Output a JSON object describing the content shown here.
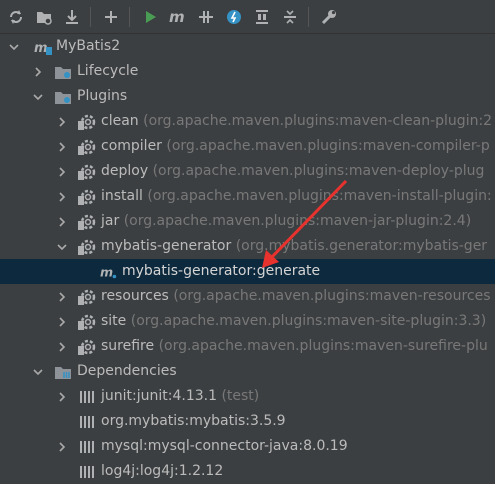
{
  "toolbar": {
    "buttons": [
      "reload-icon",
      "add-folder-icon",
      "download-icon",
      "add-icon",
      "run-icon",
      "maven-icon",
      "toggle-offline-icon",
      "thread-icon",
      "show-dependencies-icon",
      "collapse-all-icon",
      "settings-icon"
    ]
  },
  "tree": {
    "project": "MyBatis2",
    "lifecycle": "Lifecycle",
    "plugins": "Plugins",
    "plugin_items": [
      {
        "name": "clean",
        "detail": "(org.apache.maven.plugins:maven-clean-plugin:2"
      },
      {
        "name": "compiler",
        "detail": "(org.apache.maven.plugins:maven-compiler-p"
      },
      {
        "name": "deploy",
        "detail": "(org.apache.maven.plugins:maven-deploy-plug"
      },
      {
        "name": "install",
        "detail": "(org.apache.maven.plugins:maven-install-plugin:"
      },
      {
        "name": "jar",
        "detail": "(org.apache.maven.plugins:maven-jar-plugin:2.4)"
      },
      {
        "name": "mybatis-generator",
        "detail": "(org.mybatis.generator:mybatis-ger"
      },
      {
        "name": "resources",
        "detail": "(org.apache.maven.plugins:maven-resources"
      },
      {
        "name": "site",
        "detail": "(org.apache.maven.plugins:maven-site-plugin:3.3)"
      },
      {
        "name": "surefire",
        "detail": "(org.apache.maven.plugins:maven-surefire-plu"
      }
    ],
    "goal": "mybatis-generator:generate",
    "dependencies": "Dependencies",
    "dependency_items": [
      {
        "name": "junit:junit:4.13.1",
        "detail": "(test)"
      },
      {
        "name": "org.mybatis:mybatis:3.5.9",
        "detail": ""
      },
      {
        "name": "mysql:mysql-connector-java:8.0.19",
        "detail": ""
      },
      {
        "name": "log4j:log4j:1.2.12",
        "detail": ""
      }
    ]
  },
  "colors": {
    "background": "#3c3f41",
    "selection": "#0d293e",
    "text": "#bbbbbb",
    "muted": "#787878",
    "run_green": "#499c54",
    "accent_blue": "#3592c4",
    "annotation_red": "#e8322d"
  }
}
